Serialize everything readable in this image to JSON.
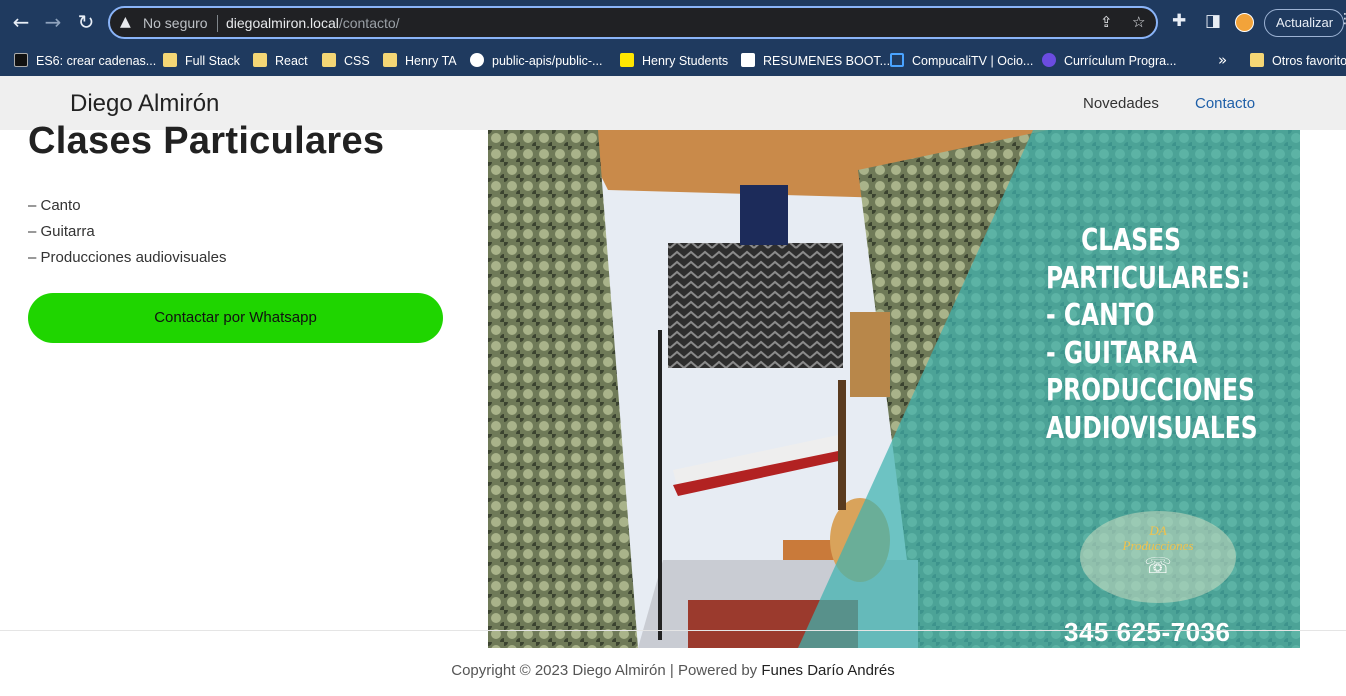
{
  "browser": {
    "insecure_label": "No seguro",
    "url_host": "diegoalmiron.local",
    "url_path": "/contacto/",
    "update_label": "Actualizar",
    "bookmarks": [
      {
        "label": "ES6: crear cadenas..."
      },
      {
        "label": "Full Stack"
      },
      {
        "label": "React"
      },
      {
        "label": "CSS"
      },
      {
        "label": "Henry TA"
      },
      {
        "label": "public-apis/public-..."
      },
      {
        "label": "Henry Students"
      },
      {
        "label": "RESUMENES BOOT..."
      },
      {
        "label": "CompucaliTV | Ocio..."
      },
      {
        "label": "Currículum Progra..."
      }
    ],
    "more_bookmarks": "»",
    "other_favorites": "Otros favoritos"
  },
  "site": {
    "title": "Diego Almirón",
    "nav": [
      {
        "label": "Novedades"
      },
      {
        "label": "Contacto"
      }
    ]
  },
  "content": {
    "heading": "Clases Particulares",
    "items": [
      "– Canto",
      "– Guitarra",
      "– Producciones audiovisuales"
    ],
    "whatsapp_button": "Contactar por Whatsapp"
  },
  "hero": {
    "text_lines": [
      "CLASES",
      "PARTICULARES:",
      "- CANTO",
      "- GUITARRA",
      "PRODUCCIONES",
      "AUDIOVISUALES"
    ],
    "logo_line1": "DA",
    "logo_line2": "Producciones",
    "phone": "345 625-7036"
  },
  "footer": {
    "prefix": "Copyright © 2023 Diego Almirón | Powered by ",
    "author": "Funes Darío Andrés"
  },
  "colors": {
    "chrome": "#1f3a5f",
    "whatsapp_green": "#1fd500",
    "accent_link": "#1e5fa8",
    "teal_overlay": "#3fb3b0"
  },
  "icons": [
    "back-arrow-icon",
    "forward-arrow-icon",
    "reload-icon",
    "warning-icon",
    "share-icon",
    "star-icon",
    "puzzle-icon",
    "sidepanel-icon",
    "menu-icon"
  ]
}
